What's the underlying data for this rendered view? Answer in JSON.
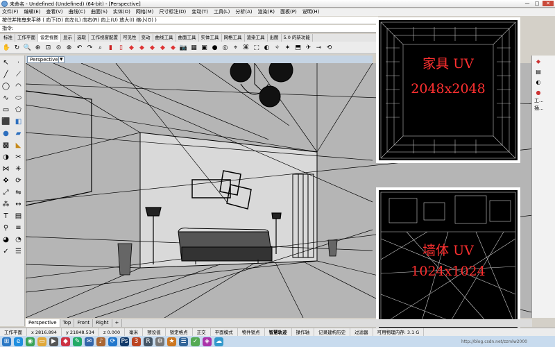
{
  "window": {
    "title": "未命名 - Undefined (Undefined) (64-bit) - [Perspective]",
    "controls": [
      "—",
      "□",
      "✕"
    ]
  },
  "menubar": {
    "items": [
      "文件(F)",
      "编辑(E)",
      "查看(V)",
      "曲线(C)",
      "曲面(S)",
      "实体(O)",
      "网格(M)",
      "尺寸标注(D)",
      "变动(T)",
      "工具(L)",
      "分析(A)",
      "渲染(R)",
      "面板(P)",
      "说明(H)"
    ]
  },
  "command": {
    "history": "按住并拖曳来平移 ( 向下(D) 向左(L) 向右(R) 向上(U) 放大(I) 缩小(O) )",
    "prompt": "指令:"
  },
  "toolbar_tabs": [
    "标准",
    "工作平面",
    "设定视图",
    "显示",
    "选取",
    "工作视窗配置",
    "可见性",
    "变动",
    "曲线工具",
    "曲面工具",
    "实体工具",
    "网格工具",
    "渲染工具",
    "出图",
    "5.0 的新功能"
  ],
  "active_tab": "设定视图",
  "viewport": {
    "label": "Perspective",
    "tabs": [
      "Perspective",
      "Top",
      "Front",
      "Right",
      "+"
    ]
  },
  "overlays": {
    "furniture_uv": {
      "title": "家具 UV",
      "size": "2048x2048"
    },
    "wall_uv": {
      "title": "墙体 UV",
      "size": "1024x1024"
    }
  },
  "right_panel": {
    "items": [
      "工...",
      "插..."
    ]
  },
  "statusbar": {
    "cplane": "工作平面",
    "x": "x 2816.894",
    "y": "y 21848.534",
    "z": "z 0.000",
    "unit": "毫米",
    "layer": "预设值",
    "toggles": [
      "锁定格点",
      "正交",
      "平面模式",
      "物件锁点",
      "智慧轨迹",
      "操作轴",
      "记录建构历史",
      "过滤器"
    ],
    "active_toggle": "智慧轨迹",
    "memory": "可用物理内存: 3.1 G"
  },
  "taskbar": {
    "watermark": "http://blog.csdn.net/zzmlw2000"
  },
  "colors": {
    "uv_text": "#ff3030",
    "viewport_bg": "#b5b5b5",
    "wall_face": "#d9d9d9"
  }
}
